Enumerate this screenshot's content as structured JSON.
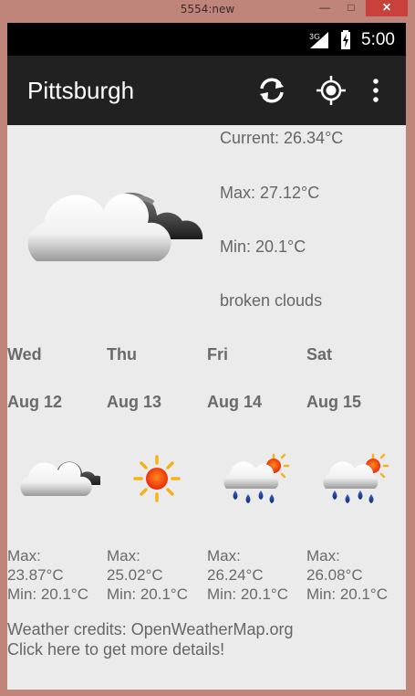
{
  "window": {
    "title": "5554:new",
    "min": "—",
    "max": "□",
    "close": "✕"
  },
  "status": {
    "network": "3G",
    "time": "5:00"
  },
  "app": {
    "city": "Pittsburgh",
    "refresh_icon": "refresh-icon",
    "locate_icon": "my-location-icon",
    "menu_icon": "overflow-menu-icon"
  },
  "current": {
    "now": "Current: 26.34°C",
    "max": "Max: 27.12°C",
    "min": "Min: 20.1°C",
    "desc": "broken clouds",
    "icon": "broken-clouds-icon"
  },
  "forecast": [
    {
      "day": "Wed",
      "date": "Aug 12",
      "icon": "broken-clouds-icon",
      "max_label": "Max:",
      "max": "23.87°C",
      "min": "Min: 20.1°C"
    },
    {
      "day": "Thu",
      "date": "Aug 13",
      "icon": "sun-icon",
      "max_label": "Max:",
      "max": "25.02°C",
      "min": "Min: 20.1°C"
    },
    {
      "day": "Fri",
      "date": "Aug 14",
      "icon": "rain-sun-icon",
      "max_label": "Max:",
      "max": "26.24°C",
      "min": "Min: 20.1°C"
    },
    {
      "day": "Sat",
      "date": "Aug 15",
      "icon": "rain-sun-icon",
      "max_label": "Max:",
      "max": "26.08°C",
      "min": "Min: 20.1°C"
    }
  ],
  "credits": {
    "line1": "Weather credits: OpenWeatherMap.org",
    "line2": "Click here to get more details!"
  }
}
